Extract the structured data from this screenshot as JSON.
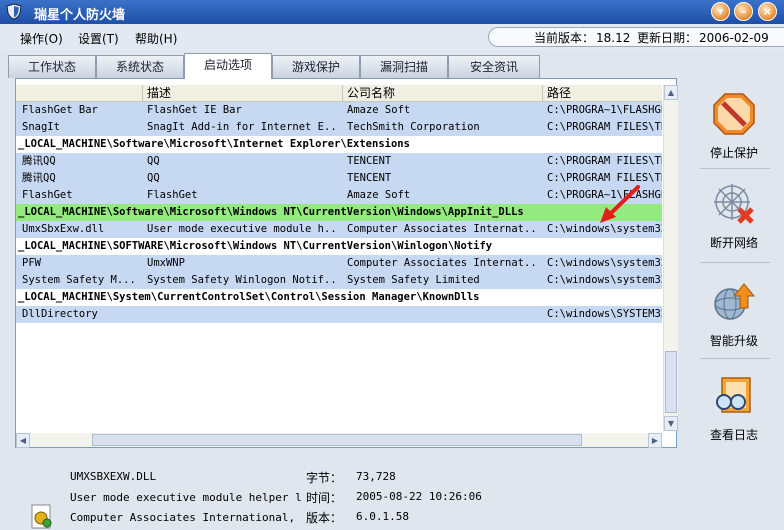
{
  "window": {
    "title": "瑞星个人防火墙"
  },
  "menu": [
    "操作(O)",
    "设置(T)",
    "帮助(H)"
  ],
  "version": {
    "current_label": "当前版本：",
    "current": "18.12",
    "update_label": "更新日期：",
    "update": "2006-02-09"
  },
  "tabs": [
    {
      "label": "工作状态"
    },
    {
      "label": "系统状态"
    },
    {
      "label": "启动选项",
      "active": true
    },
    {
      "label": "游戏保护"
    },
    {
      "label": "漏洞扫描"
    },
    {
      "label": "安全资讯"
    }
  ],
  "columns": [
    "描述",
    "公司名称",
    "路径"
  ],
  "rows": [
    {
      "kind": "item",
      "name": "FlashGet Bar",
      "desc": "FlashGet IE Bar",
      "company": "Amaze Soft",
      "path": "C:\\PROGRA~1\\FLASHGE"
    },
    {
      "kind": "item",
      "name": "SnagIt",
      "desc": "SnagIt Add-in for Internet E...",
      "company": "TechSmith Corporation",
      "path": "C:\\PROGRAM FILES\\TE"
    },
    {
      "kind": "key",
      "name": "_LOCAL_MACHINE\\Software\\Microsoft\\Internet Explorer\\Extensions"
    },
    {
      "kind": "item",
      "name": "腾讯QQ",
      "desc": "QQ",
      "company": "TENCENT",
      "path": "C:\\PROGRAM FILES\\TE"
    },
    {
      "kind": "item",
      "name": "腾讯QQ",
      "desc": "QQ",
      "company": "TENCENT",
      "path": "C:\\PROGRAM FILES\\TE"
    },
    {
      "kind": "item",
      "name": "FlashGet",
      "desc": "FlashGet",
      "company": "Amaze Soft",
      "path": "C:\\PROGRA~1\\FLASHGE"
    },
    {
      "kind": "key",
      "highlight": true,
      "name": "_LOCAL_MACHINE\\Software\\Microsoft\\Windows NT\\CurrentVersion\\Windows\\AppInit_DLLs"
    },
    {
      "kind": "item",
      "name": "UmxSbxExw.dll",
      "desc": "User mode executive module h...",
      "company": "Computer Associates Internat...",
      "path": "C:\\windows\\system32"
    },
    {
      "kind": "key",
      "name": "_LOCAL_MACHINE\\SOFTWARE\\Microsoft\\Windows NT\\CurrentVersion\\Winlogon\\Notify"
    },
    {
      "kind": "item",
      "name": "PFW",
      "desc": "UmxWNP",
      "company": "Computer Associates Internat...",
      "path": "C:\\windows\\system32"
    },
    {
      "kind": "item",
      "name": "System Safety M...",
      "desc": "System Safety Winlogon Notif...",
      "company": "System Safety Limited",
      "path": "C:\\windows\\system32"
    },
    {
      "kind": "key",
      "name": "_LOCAL_MACHINE\\System\\CurrentControlSet\\Control\\Session Manager\\KnownDlls"
    },
    {
      "kind": "item",
      "name": "DllDirectory",
      "desc": "",
      "company": "",
      "path": "C:\\windows\\SYSTEM32"
    }
  ],
  "details": {
    "filename": "UMXSBXEXW.DLL",
    "description": "User mode executive module helper l",
    "company": "Computer Associates International,",
    "size_label": "字节：",
    "size": "73,728",
    "time_label": "时间：",
    "time": "2005-08-22 10:26:06",
    "version_label": "版本：",
    "version": "6.0.1.58"
  },
  "sidebar": [
    {
      "label": "停止保护",
      "icon": "stop-icon"
    },
    {
      "label": "断开网络",
      "icon": "disconnect-icon"
    },
    {
      "label": "智能升级",
      "icon": "upgrade-icon"
    },
    {
      "label": "查看日志",
      "icon": "log-icon"
    }
  ],
  "colors": {
    "titlebar": "#2a5db8",
    "row_selected": "#c6d8f2",
    "key_highlight": "#94ea80",
    "arrow": "#e51c1c"
  }
}
